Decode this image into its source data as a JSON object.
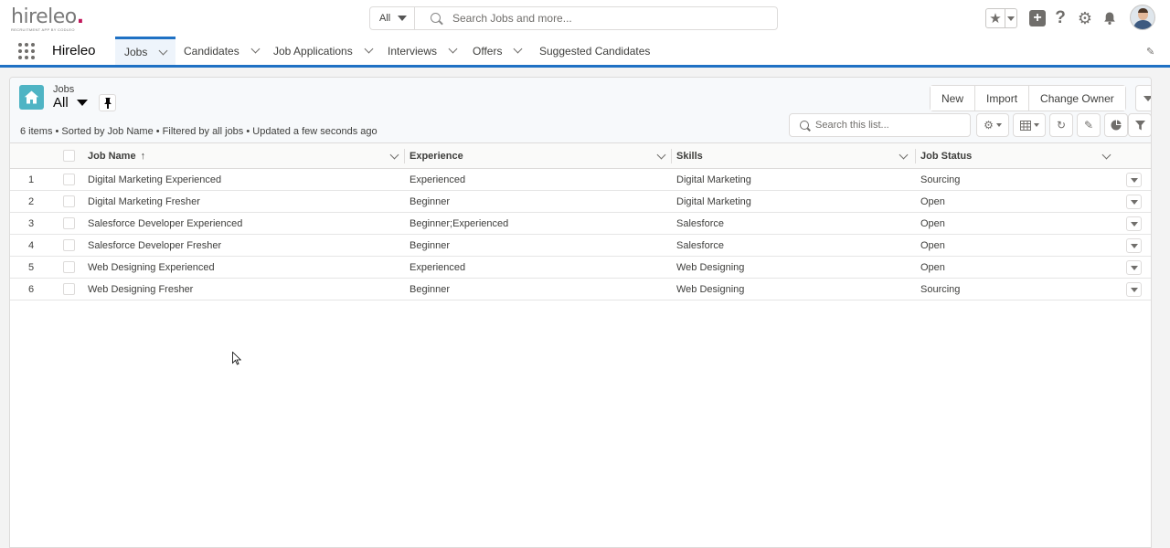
{
  "header": {
    "logo_text": "hireleo",
    "logo_tagline": "RECRUITMENT APP BY CODLEO",
    "search_scope": "All",
    "search_placeholder": "Search Jobs and more...",
    "icons": [
      "favorites-star-icon",
      "add-icon",
      "help-icon",
      "setup-gear-icon",
      "notifications-bell-icon",
      "user-avatar"
    ]
  },
  "nav": {
    "app_name": "Hireleo",
    "tabs": [
      {
        "label": "Jobs",
        "active": true
      },
      {
        "label": "Candidates"
      },
      {
        "label": "Job Applications"
      },
      {
        "label": "Interviews"
      },
      {
        "label": "Offers"
      },
      {
        "label": "Suggested Candidates"
      }
    ]
  },
  "list_view": {
    "object_label": "Jobs",
    "view_name": "All",
    "buttons": [
      "New",
      "Import",
      "Change Owner"
    ],
    "info": "6 items • Sorted by Job Name • Filtered by all jobs • Updated a few seconds ago",
    "search_placeholder": "Search this list...",
    "columns": [
      "Job Name",
      "Experience",
      "Skills",
      "Job Status"
    ],
    "sort_indicator": "↑",
    "rows": [
      {
        "num": "1",
        "job_name": "Digital Marketing Experienced",
        "experience": "Experienced",
        "skills": "Digital Marketing",
        "status": "Sourcing"
      },
      {
        "num": "2",
        "job_name": "Digital Marketing Fresher",
        "experience": "Beginner",
        "skills": "Digital Marketing",
        "status": "Open"
      },
      {
        "num": "3",
        "job_name": "Salesforce Developer Experienced",
        "experience": "Beginner;Experienced",
        "skills": "Salesforce",
        "status": "Open"
      },
      {
        "num": "4",
        "job_name": "Salesforce Developer Fresher",
        "experience": "Beginner",
        "skills": "Salesforce",
        "status": "Open"
      },
      {
        "num": "5",
        "job_name": "Web Designing Experienced",
        "experience": "Experienced",
        "skills": "Web Designing",
        "status": "Open"
      },
      {
        "num": "6",
        "job_name": "Web Designing Fresher",
        "experience": "Beginner",
        "skills": "Web Designing",
        "status": "Sourcing"
      }
    ]
  },
  "colors": {
    "brand_blue": "#1f71c4",
    "object_icon": "#4fb4c4",
    "logo_accent": "#c2185b"
  }
}
